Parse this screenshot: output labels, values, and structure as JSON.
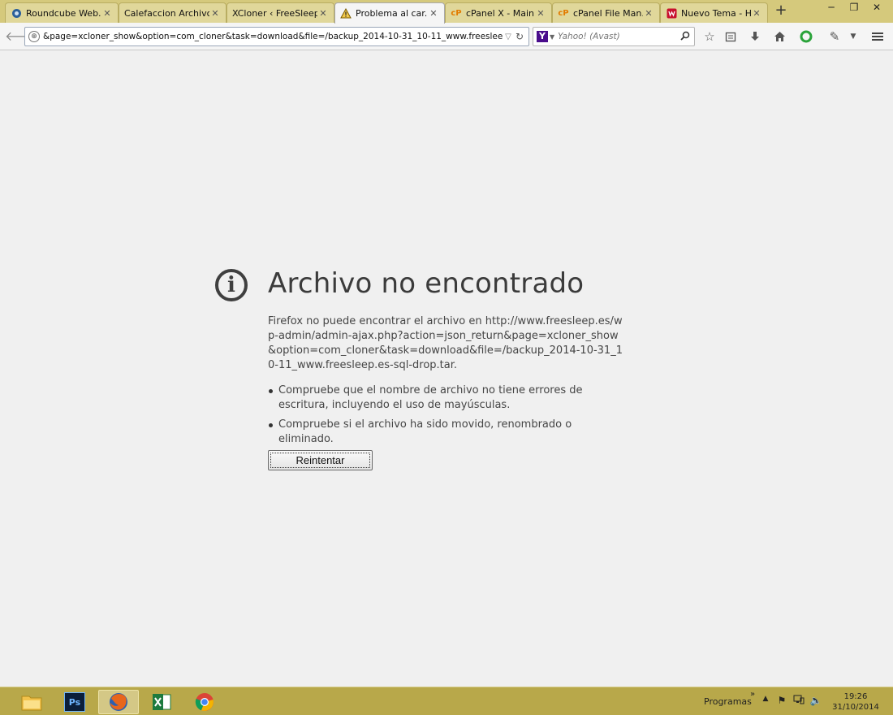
{
  "tabs": [
    {
      "label": "Roundcube Web...",
      "icon": "roundcube-icon",
      "active": false
    },
    {
      "label": "Calefaccion Archivo...",
      "icon": "",
      "active": false
    },
    {
      "label": "XCloner ‹ FreeSleep ...",
      "icon": "",
      "active": false
    },
    {
      "label": "Problema al car...",
      "icon": "warning-icon",
      "active": true
    },
    {
      "label": "cPanel X - Main",
      "icon": "cpanel-icon",
      "active": false
    },
    {
      "label": "cPanel File Man...",
      "icon": "cpanel-icon",
      "active": false
    },
    {
      "label": "Nuevo Tema - H...",
      "icon": "forum-icon",
      "active": false
    }
  ],
  "navbar": {
    "url": "&page=xcloner_show&option=com_cloner&task=download&file=/backup_2014-10-31_10-11_www.freesleep.es-sql-drop.tar",
    "search_placeholder": "Yahoo! (Avast)"
  },
  "error": {
    "title": "Archivo no encontrado",
    "description": "Firefox no puede encontrar el archivo en http://www.freesleep.es/wp-admin/admin-ajax.php?action=json_return&page=xcloner_show&option=com_cloner&task=download&file=/backup_2014-10-31_10-11_www.freesleep.es-sql-drop.tar.",
    "suggestions": [
      "Compruebe que el nombre de archivo no tiene errores de escritura, incluyendo el uso de mayúsculas.",
      "Compruebe si el archivo ha sido movido, renombrado o eliminado."
    ],
    "retry_label": "Reintentar"
  },
  "taskbar": {
    "apps": [
      {
        "name": "file-explorer",
        "active": false
      },
      {
        "name": "photoshop",
        "active": false,
        "label": "Ps"
      },
      {
        "name": "firefox",
        "active": true
      },
      {
        "name": "excel",
        "active": false
      },
      {
        "name": "chrome",
        "active": false
      }
    ],
    "programs_label": "Programas",
    "time": "19:26",
    "date": "31/10/2014"
  },
  "colors": {
    "accent": "#b8a84a",
    "tabstrip": "#d5c97c"
  }
}
